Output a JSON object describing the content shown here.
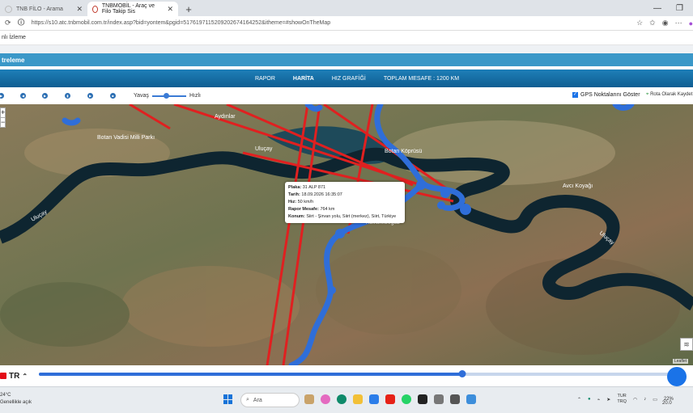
{
  "tabs": [
    {
      "label": "TNB FİLO - Arama",
      "active": false
    },
    {
      "label": "TNBMOBİL - Araç ve Filo Takip Sis",
      "active": true
    }
  ],
  "address": {
    "url": "https://s10.atc.tnbmobil.com.tr/index.asp?bid=yontem&pgid=5176197115209202674164252&itheme=#showOnTheMap"
  },
  "favbar": {
    "label": "nlı İzleme"
  },
  "section": {
    "title": "treleme"
  },
  "menu": {
    "items": [
      "RAPOR",
      "HARİTA",
      "HIZ GRAFİĞİ",
      "TOPLAM MESAFE : 1200 KM"
    ],
    "active": 1
  },
  "controls": {
    "slow_label": "Yavaş",
    "fast_label": "Hızlı",
    "gps_label": "GPS Noktalarını Göster",
    "gps_checked": true,
    "route_label": "Rota Olarak Kaydet"
  },
  "map": {
    "labels": [
      "Botan Vadisi Milli Parkı",
      "Uluçay",
      "Uluçay",
      "Uluçay",
      "Botan Köprüsü",
      "Aydınlar",
      "Kavaklıboğaz",
      "Avcı Koyağı"
    ],
    "popup": [
      {
        "key": "Plaka:",
        "value": "31 ALP 871"
      },
      {
        "key": "Tarih:",
        "value": "18.09.2026 16:35:07"
      },
      {
        "key": "Hız:",
        "value": "50 km/h"
      },
      {
        "key": "Rapor Mesafe:",
        "value": "764 km"
      },
      {
        "key": "Konum:",
        "value": "Siirt - Şirvan yolu, Siirt (merkez), Siirt, Türkiye"
      }
    ],
    "attribution": "Leaflet"
  },
  "playback": {
    "lang": "TR",
    "progress_pct": 66
  },
  "taskbar": {
    "temp": "24°C",
    "weather": "Genellikle açık",
    "search": "Ara",
    "lang_top": "TUR",
    "lang_bottom": "TRQ",
    "battery": "22%",
    "time": "20.0"
  },
  "colors": {
    "route": "#e02020",
    "track": "#2f6ed9",
    "menu": "#1e7fb8",
    "filter": "#3a98c8"
  }
}
